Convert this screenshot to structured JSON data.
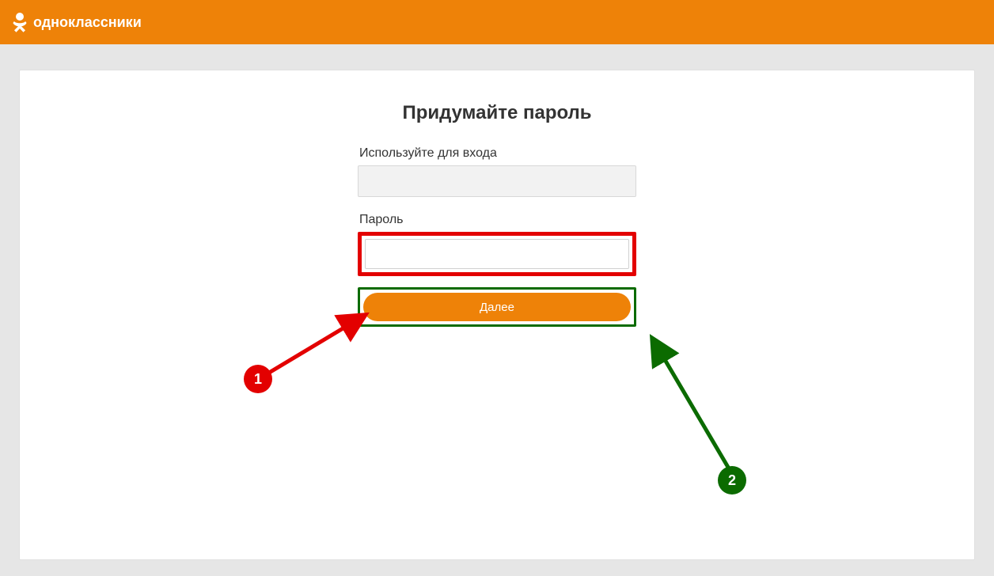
{
  "brand": {
    "name": "одноклассники"
  },
  "form": {
    "title": "Придумайте пароль",
    "login_label": "Используйте для входа",
    "login_value": "",
    "password_label": "Пароль",
    "password_value": "",
    "next_label": "Далее"
  },
  "annotations": {
    "step1": "1",
    "step2": "2"
  },
  "colors": {
    "brand": "#ee8208",
    "highlight_red": "#e30000",
    "highlight_green": "#0b6b00"
  }
}
